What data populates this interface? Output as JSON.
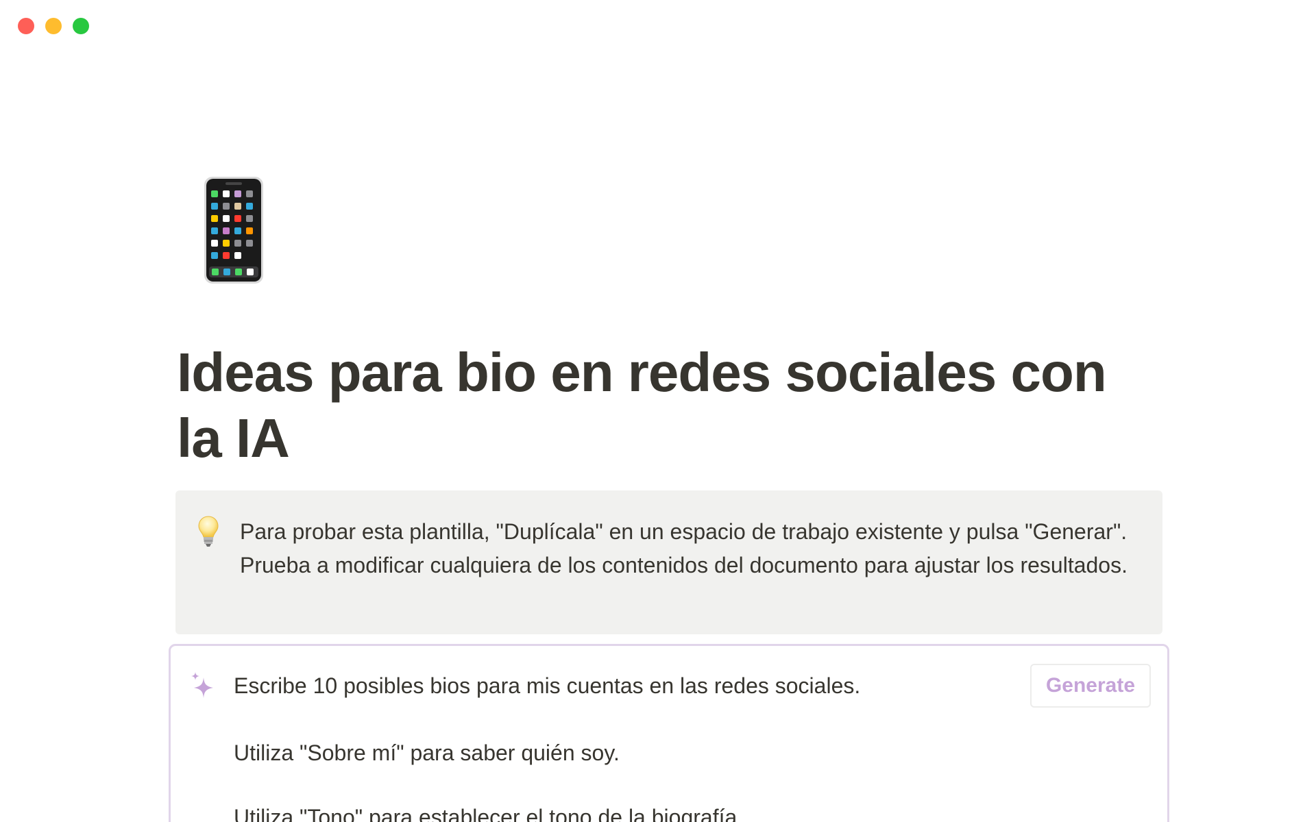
{
  "window": {
    "controls": [
      "close",
      "minimize",
      "maximize"
    ]
  },
  "page": {
    "icon": "mobile-phone-icon",
    "title": "Ideas para bio en redes sociales con la IA"
  },
  "callout": {
    "icon": "light-bulb-icon",
    "text": "Para probar esta plantilla, \"Duplícala\" en un espacio de trabajo existente y pulsa \"Generar\". Prueba a modificar cualquiera de los contenidos del documento para ajustar los resultados."
  },
  "ai_block": {
    "icon": "sparkle-icon",
    "lines": [
      "Escribe 10 posibles bios para mis cuentas en las redes sociales.",
      "Utiliza \"Sobre mí\" para saber quién soy.",
      "Utiliza \"Tono\" para establecer el tono de la biografía."
    ],
    "generate_label": "Generate",
    "accent_color": "#c5a3d8"
  }
}
